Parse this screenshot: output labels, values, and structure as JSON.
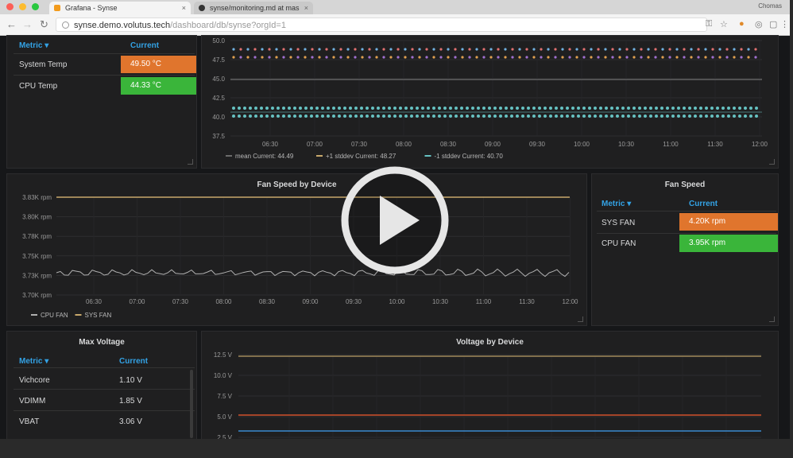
{
  "browser": {
    "tabs": [
      {
        "title": "Grafana - Synse",
        "active": true
      },
      {
        "title": "synse/monitoring.md at mas",
        "active": false
      }
    ],
    "user": "Chomas",
    "url_host": "synse.demo.volutus.tech",
    "url_path": "/dashboard/db/synse?orgId=1"
  },
  "temp_panel": {
    "header_metric": "Metric ▾",
    "header_current": "Current",
    "rows": [
      {
        "name": "System Temp",
        "value": "49.50 °C",
        "color": "#e0752d"
      },
      {
        "name": "CPU Temp",
        "value": "44.33 °C",
        "color": "#3ab53a"
      }
    ]
  },
  "temp_graph": {
    "y_ticks": [
      "50.0",
      "47.5",
      "45.0",
      "42.5",
      "40.0",
      "37.5"
    ],
    "x_ticks": [
      "06:30",
      "07:00",
      "07:30",
      "08:00",
      "08:30",
      "09:00",
      "09:30",
      "10:00",
      "10:30",
      "11:00",
      "11:30",
      "12:00"
    ],
    "legend": [
      {
        "label": "mean  Current: 44.49",
        "color": "#6b6b6b"
      },
      {
        "label": "+1 stddev  Current: 48.27",
        "color": "#c8a86b"
      },
      {
        "label": "-1 stddev  Current: 40.70",
        "color": "#66c2c2"
      }
    ]
  },
  "fan_graph": {
    "title": "Fan Speed by Device",
    "y_ticks": [
      "3.83K rpm",
      "3.80K rpm",
      "3.78K rpm",
      "3.75K rpm",
      "3.73K rpm",
      "3.70K rpm"
    ],
    "x_ticks": [
      "06:30",
      "07:00",
      "07:30",
      "08:00",
      "08:30",
      "09:00",
      "09:30",
      "10:00",
      "10:30",
      "11:00",
      "11:30",
      "12:00"
    ],
    "legend": [
      {
        "label": "CPU FAN",
        "color": "#b0b0b0"
      },
      {
        "label": "SYS FAN",
        "color": "#c8a86b"
      }
    ]
  },
  "fan_panel": {
    "title": "Fan Speed",
    "header_metric": "Metric ▾",
    "header_current": "Current",
    "rows": [
      {
        "name": "SYS FAN",
        "value": "4.20K rpm",
        "color": "#e0752d"
      },
      {
        "name": "CPU FAN",
        "value": "3.95K rpm",
        "color": "#3ab53a"
      }
    ]
  },
  "volt_panel": {
    "title": "Max Voltage",
    "header_metric": "Metric ▾",
    "header_current": "Current",
    "rows": [
      {
        "name": "Vichcore",
        "value": "1.10 V"
      },
      {
        "name": "VDIMM",
        "value": "1.85 V"
      },
      {
        "name": "VBAT",
        "value": "3.06 V"
      }
    ]
  },
  "volt_graph": {
    "title": "Voltage by Device",
    "y_ticks": [
      "12.5 V",
      "10.0 V",
      "7.5 V",
      "5.0 V",
      "2.5 V"
    ],
    "series_colors": [
      "#a08a5a",
      "#d0502a",
      "#3a8ad0"
    ]
  },
  "overlay": {
    "icon": "play-icon"
  }
}
